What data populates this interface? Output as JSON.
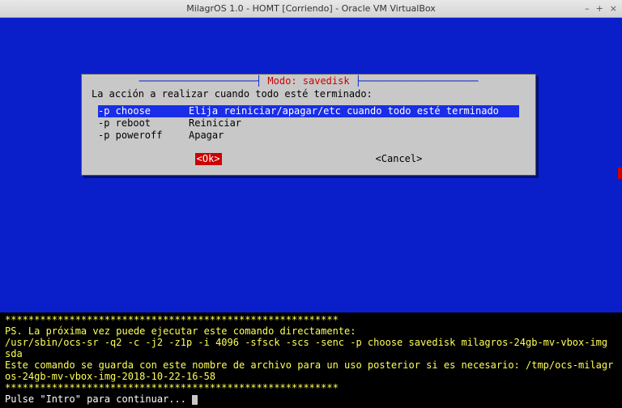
{
  "window": {
    "title": "MilagrOS 1.0 - HOMT [Corriendo] - Oracle VM VirtualBox",
    "controls": {
      "min": "–",
      "max": "+",
      "close": "×"
    }
  },
  "dialog": {
    "rule_left": "────────────────────┤ ",
    "mode_label": "Modo: savedisk",
    "rule_right": " ├────────────────────",
    "prompt": "La acción a realizar cuando todo esté terminado:",
    "options": [
      {
        "flag": "-p choose",
        "desc": "Elija reiniciar/apagar/etc cuando todo esté terminado",
        "selected": true
      },
      {
        "flag": "-p reboot",
        "desc": "Reiniciar",
        "selected": false
      },
      {
        "flag": "-p poweroff",
        "desc": "Apagar",
        "selected": false
      }
    ],
    "ok": "<Ok>",
    "cancel": "<Cancel>"
  },
  "terminal": {
    "stars": "*********************************************************",
    "ps_line": "PS. La próxima vez puede ejecutar este comando directamente:",
    "cmd_line": "/usr/sbin/ocs-sr -q2 -c -j2 -z1p -i 4096 -sfsck -scs -senc -p choose savedisk milagros-24gb-mv-vbox-img sda",
    "save_line": "Este comando se guarda con este nombre de archivo para un uso posterior si es necesario: /tmp/ocs-milagros-24gb-mv-vbox-img-2018-10-22-16-58",
    "continue": "Pulse \"Intro\" para continuar... "
  }
}
